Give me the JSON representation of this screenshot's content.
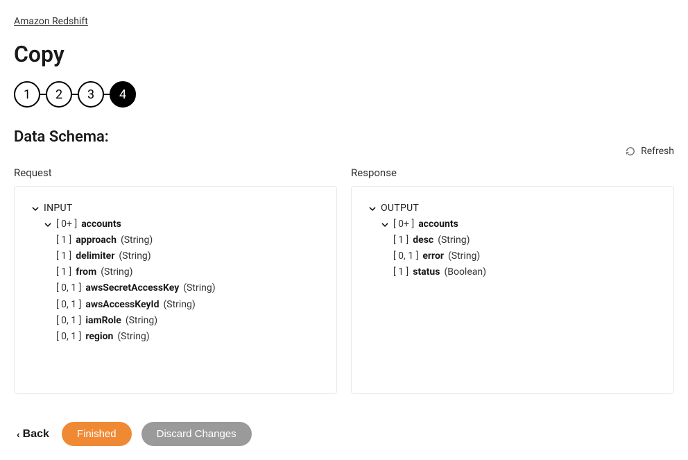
{
  "breadcrumb": {
    "label": "Amazon Redshift"
  },
  "title": "Copy",
  "stepper": {
    "steps": [
      "1",
      "2",
      "3",
      "4"
    ],
    "active_index": 3
  },
  "section": {
    "heading": "Data Schema:"
  },
  "refresh": {
    "label": "Refresh"
  },
  "request": {
    "label": "Request",
    "root": "INPUT",
    "group": {
      "cardinality": "[ 0+ ]",
      "name": "accounts"
    },
    "fields": [
      {
        "cardinality": "[ 1 ]",
        "name": "approach",
        "type": "(String)"
      },
      {
        "cardinality": "[ 1 ]",
        "name": "delimiter",
        "type": "(String)"
      },
      {
        "cardinality": "[ 1 ]",
        "name": "from",
        "type": "(String)"
      },
      {
        "cardinality": "[ 0, 1 ]",
        "name": "awsSecretAccessKey",
        "type": "(String)"
      },
      {
        "cardinality": "[ 0, 1 ]",
        "name": "awsAccessKeyId",
        "type": "(String)"
      },
      {
        "cardinality": "[ 0, 1 ]",
        "name": "iamRole",
        "type": "(String)"
      },
      {
        "cardinality": "[ 0, 1 ]",
        "name": "region",
        "type": "(String)"
      }
    ]
  },
  "response": {
    "label": "Response",
    "root": "OUTPUT",
    "group": {
      "cardinality": "[ 0+ ]",
      "name": "accounts"
    },
    "fields": [
      {
        "cardinality": "[ 1 ]",
        "name": "desc",
        "type": "(String)"
      },
      {
        "cardinality": "[ 0, 1 ]",
        "name": "error",
        "type": "(String)"
      },
      {
        "cardinality": "[ 1 ]",
        "name": "status",
        "type": "(Boolean)"
      }
    ]
  },
  "footer": {
    "back": "Back",
    "finished": "Finished",
    "discard": "Discard Changes"
  }
}
